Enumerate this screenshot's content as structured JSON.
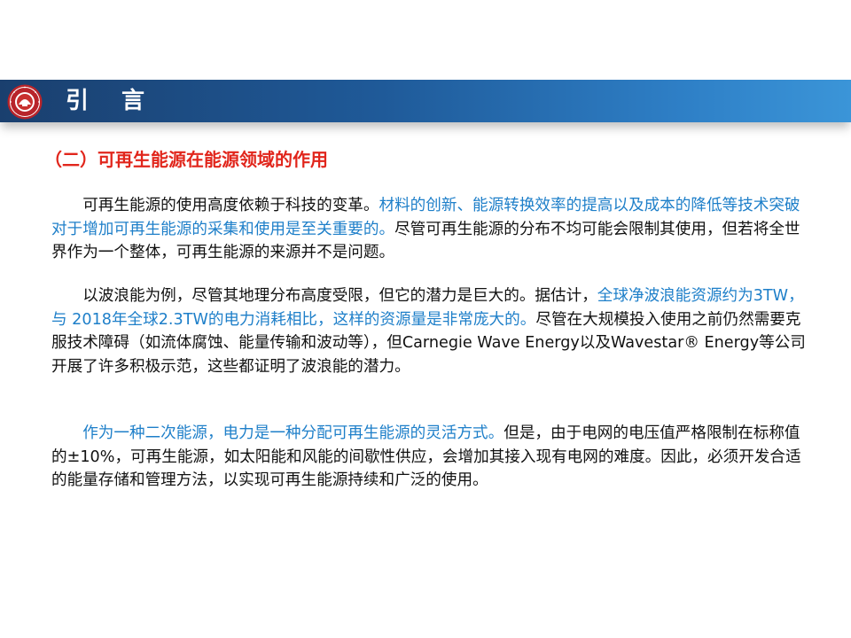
{
  "header": {
    "title": "引 言",
    "emblem_icon": "university-seal-icon",
    "bar_colors": [
      "#1a3f6e",
      "#3b95d8"
    ]
  },
  "section": {
    "heading": "（二）可再生能源在能源领域的作用",
    "heading_color": "#e1261c"
  },
  "highlight_color": "#1e7fc9",
  "paragraphs": [
    {
      "s1": "可再生能源的使用高度依赖于科技的变革。",
      "s2": "材料的创新、能源转换效率的提高以及成本的降低等技术突破对于增加可再生能源的采集和使用是至关重要的。",
      "s3": "尽管可再生能源的分布不均可能会限制其使用，但若将全世界作为一个整体，可再生能源的来源并不是问题。"
    },
    {
      "s1": "以波浪能为例，尽管其地理分布高度受限，但它的潜力是巨大的。据估计，",
      "s2": "全球净波浪能资源约为3TW，与 2018年全球2.3TW的电力消耗相比，这样的资源量是非常庞大的。",
      "s3": "尽管在大规模投入使用之前仍然需要克服技术障碍（如流体腐蚀、能量传输和波动等），但Carnegie Wave Energy以及Wavestar® Energy等公司开展了许多积极示范，这些都证明了波浪能的潜力。"
    },
    {
      "s1": "作为一种二次能源，电力是一种分配可再生能源的灵活方式。",
      "s2": "但是，由于电网的电压值严格限制在标称值的±10%，可再生能源，如太阳能和风能的间歇性供应，会增加其接入现有电网的难度。因此，必须开发合适的能量存储和管理方法，以实现可再生能源持续和广泛的使用。"
    }
  ]
}
